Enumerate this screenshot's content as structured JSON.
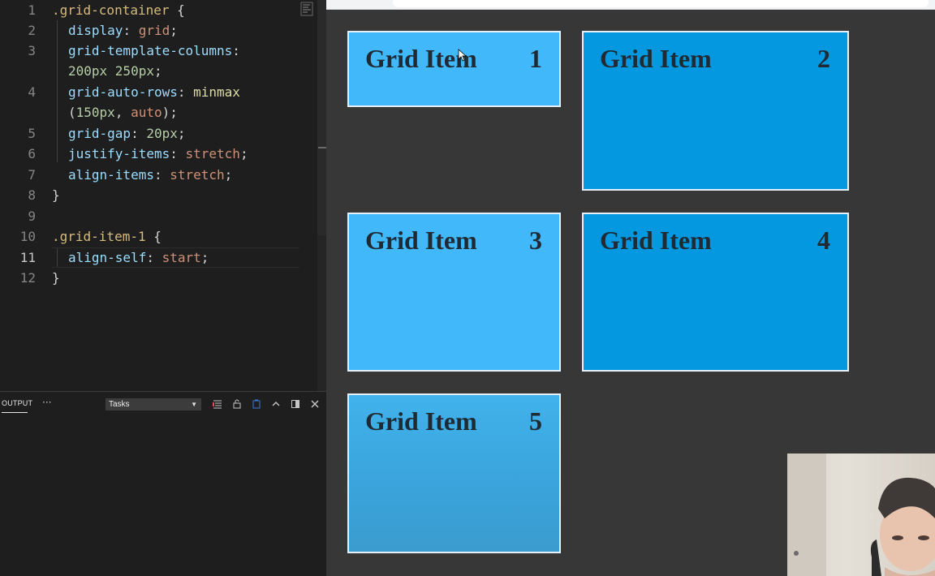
{
  "editor": {
    "lines": [
      {
        "n": "1"
      },
      {
        "n": "2"
      },
      {
        "n": "3"
      },
      {
        "n": "4"
      },
      {
        "n": "5"
      },
      {
        "n": "6"
      },
      {
        "n": "7"
      },
      {
        "n": "8"
      },
      {
        "n": "9"
      },
      {
        "n": "10"
      },
      {
        "n": "11"
      },
      {
        "n": "12"
      }
    ],
    "tokens": {
      "l1_sel": ".grid-container",
      "l1_brace": " {",
      "l2_prop": "display",
      "l2_val": "grid",
      "l3_prop": "grid-template-columns",
      "l3_val": "200px 250px",
      "l4_prop": "grid-auto-rows",
      "l4_fn": "minmax",
      "l4_open": "(",
      "l4_a": "150px",
      "l4_comma": ", ",
      "l4_b": "auto",
      "l4_close": ");",
      "l5_prop": "grid-gap",
      "l5_val": "20px",
      "l6_prop": "justify-items",
      "l6_val": "stretch",
      "l7_prop": "align-items",
      "l7_val": "stretch",
      "l8_close": "}",
      "l10_sel": ".grid-item-1",
      "l10_brace": " {",
      "l11_prop": "align-self",
      "l11_val": "start",
      "l12_close": "}",
      "colon": ": ",
      "semi": ";"
    },
    "active_line": "11"
  },
  "panel": {
    "title": "OUTPUT",
    "more": "···",
    "task_select": "Tasks",
    "task_caret": "▼"
  },
  "browser": {
    "items": [
      {
        "label": "Grid Item",
        "num": "1"
      },
      {
        "label": "Grid Item",
        "num": "2"
      },
      {
        "label": "Grid Item",
        "num": "3"
      },
      {
        "label": "Grid Item",
        "num": "4"
      },
      {
        "label": "Grid Item",
        "num": "5"
      }
    ],
    "colors": {
      "light": "#41b8f9",
      "dark": "#0398e0",
      "background": "#373737"
    }
  },
  "icons": {
    "panel_toolbar": [
      "clear-output-icon",
      "lock-scroll-icon",
      "open-log-icon",
      "maximize-panel-icon",
      "toggle-layout-icon",
      "close-panel-icon"
    ]
  }
}
